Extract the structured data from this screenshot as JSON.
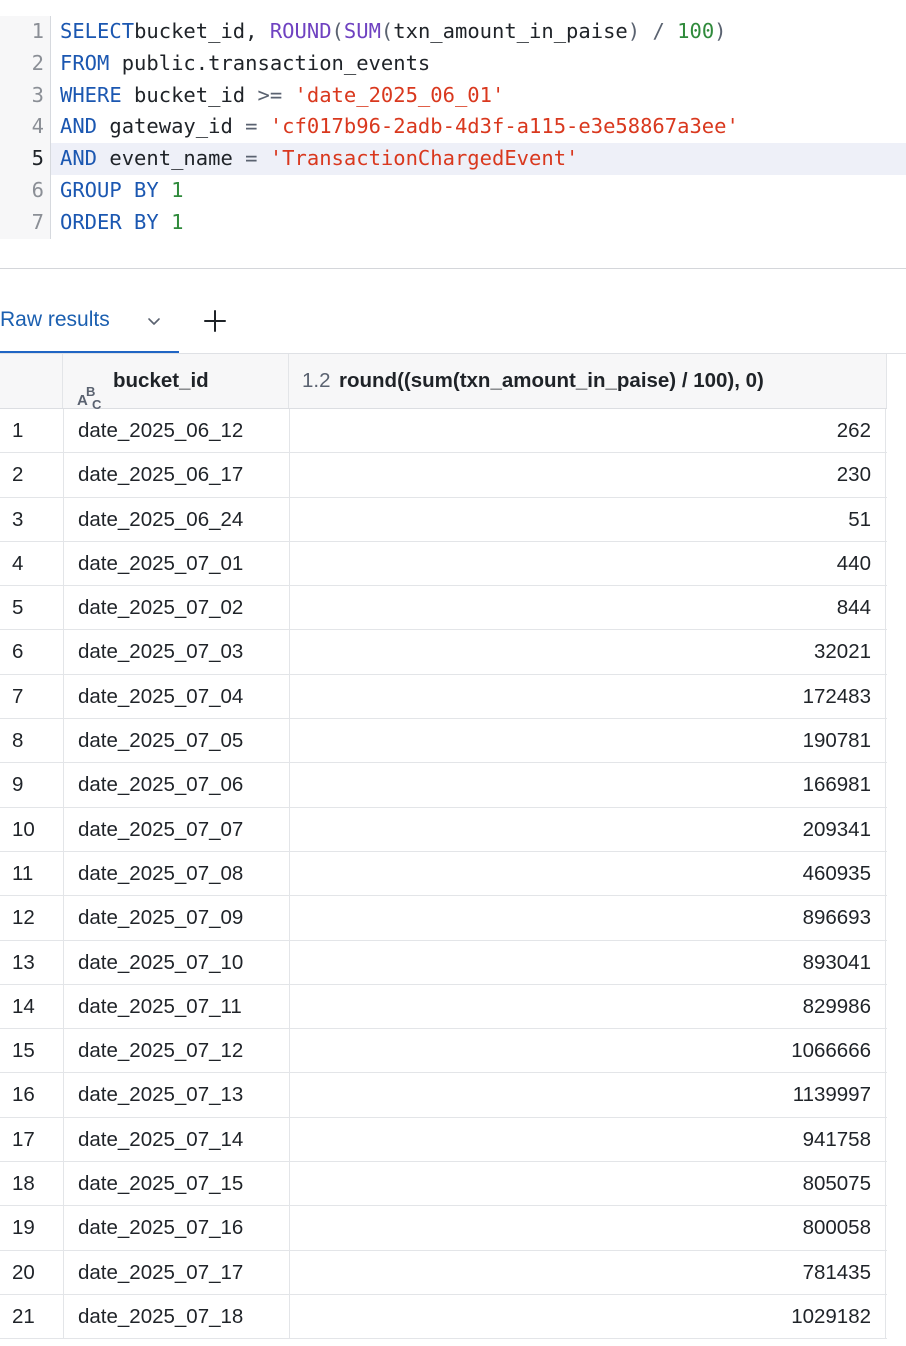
{
  "editor": {
    "lines": [
      {
        "n": "1",
        "html": [
          [
            "kw",
            "SELECT"
          ],
          [
            "",
            "bucket_id, "
          ],
          [
            "fn",
            "ROUND"
          ],
          [
            "op",
            "("
          ],
          [
            "fn",
            "SUM"
          ],
          [
            "op",
            "("
          ],
          [
            "",
            "txn_amount_in_paise"
          ],
          [
            "op",
            ")"
          ],
          [
            "",
            " "
          ],
          [
            "op",
            "/"
          ],
          [
            "",
            " "
          ],
          [
            "num",
            "100"
          ],
          [
            "op",
            ")"
          ]
        ]
      },
      {
        "n": "2",
        "html": [
          [
            "kw",
            "FROM"
          ],
          [
            "",
            " public.transaction_events"
          ]
        ]
      },
      {
        "n": "3",
        "html": [
          [
            "kw",
            "WHERE"
          ],
          [
            "",
            " bucket_id "
          ],
          [
            "op",
            ">="
          ],
          [
            "",
            " "
          ],
          [
            "str",
            "'date_2025_06_01'"
          ]
        ]
      },
      {
        "n": "4",
        "html": [
          [
            "kw",
            "AND"
          ],
          [
            "",
            " gateway_id "
          ],
          [
            "op",
            "="
          ],
          [
            "",
            " "
          ],
          [
            "str",
            "'cf017b96-2adb-4d3f-a115-e3e58867a3ee'"
          ]
        ]
      },
      {
        "n": "5",
        "html": [
          [
            "kw",
            "AND"
          ],
          [
            "",
            " event_name "
          ],
          [
            "op",
            "="
          ],
          [
            "",
            " "
          ],
          [
            "str",
            "'TransactionChargedEvent'"
          ]
        ]
      },
      {
        "n": "6",
        "html": [
          [
            "kw",
            "GROUP BY"
          ],
          [
            "",
            " "
          ],
          [
            "num",
            "1"
          ]
        ]
      },
      {
        "n": "7",
        "html": [
          [
            "kw",
            "ORDER BY"
          ],
          [
            "",
            " "
          ],
          [
            "num",
            "1"
          ]
        ]
      }
    ],
    "active_line": 5
  },
  "tabs": {
    "raw_results_label": "Raw results",
    "add_icon": "plus-icon",
    "chevron_icon": "chevron-down-icon"
  },
  "grid": {
    "columns": {
      "bucket_type": "ABC",
      "bucket_name": "bucket_id",
      "round_type": "1.2",
      "round_name": "round((sum(txn_amount_in_paise) / 100), 0)"
    },
    "rows": [
      {
        "i": "1",
        "bucket": "date_2025_06_12",
        "value": "262"
      },
      {
        "i": "2",
        "bucket": "date_2025_06_17",
        "value": "230"
      },
      {
        "i": "3",
        "bucket": "date_2025_06_24",
        "value": "51"
      },
      {
        "i": "4",
        "bucket": "date_2025_07_01",
        "value": "440"
      },
      {
        "i": "5",
        "bucket": "date_2025_07_02",
        "value": "844"
      },
      {
        "i": "6",
        "bucket": "date_2025_07_03",
        "value": "32021"
      },
      {
        "i": "7",
        "bucket": "date_2025_07_04",
        "value": "172483"
      },
      {
        "i": "8",
        "bucket": "date_2025_07_05",
        "value": "190781"
      },
      {
        "i": "9",
        "bucket": "date_2025_07_06",
        "value": "166981"
      },
      {
        "i": "10",
        "bucket": "date_2025_07_07",
        "value": "209341"
      },
      {
        "i": "11",
        "bucket": "date_2025_07_08",
        "value": "460935"
      },
      {
        "i": "12",
        "bucket": "date_2025_07_09",
        "value": "896693"
      },
      {
        "i": "13",
        "bucket": "date_2025_07_10",
        "value": "893041"
      },
      {
        "i": "14",
        "bucket": "date_2025_07_11",
        "value": "829986"
      },
      {
        "i": "15",
        "bucket": "date_2025_07_12",
        "value": "1066666"
      },
      {
        "i": "16",
        "bucket": "date_2025_07_13",
        "value": "1139997"
      },
      {
        "i": "17",
        "bucket": "date_2025_07_14",
        "value": "941758"
      },
      {
        "i": "18",
        "bucket": "date_2025_07_15",
        "value": "805075"
      },
      {
        "i": "19",
        "bucket": "date_2025_07_16",
        "value": "800058"
      },
      {
        "i": "20",
        "bucket": "date_2025_07_17",
        "value": "781435"
      },
      {
        "i": "21",
        "bucket": "date_2025_07_18",
        "value": "1029182"
      }
    ]
  },
  "colors": {
    "keyword": "#1b57b1",
    "function": "#6f42c1",
    "string": "#d9381e",
    "number": "#2f8a3b",
    "tab_active": "#2065c4"
  }
}
